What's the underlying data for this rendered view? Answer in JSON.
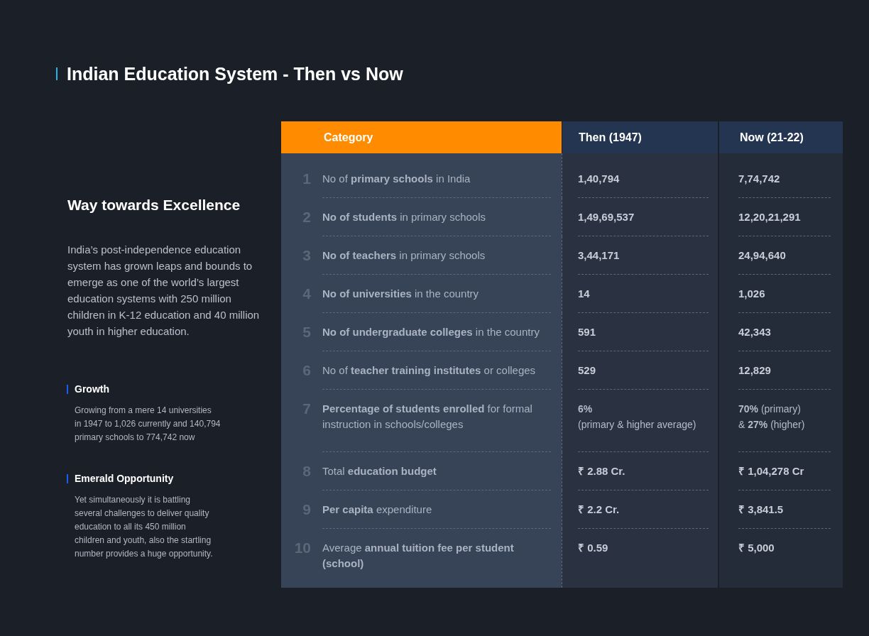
{
  "title": "Indian Education System - Then vs Now",
  "intro": {
    "heading": "Way towards Excellence",
    "text": "India’s post-independence education system has grown leaps and bounds to emerge as one of the world’s largest education systems with 250 million children in K-12 education and 40 million youth in higher education."
  },
  "highlights": [
    {
      "heading": "Growth",
      "text": "Growing from a mere 14 universities\nin 1947 to 1,026 currently and 140,794\nprimary schools to 774,742 now"
    },
    {
      "heading": "Emerald Opportunity",
      "text": "Yet simultaneously it is battling\nseveral challenges to deliver quality\neducation to all its 450 million\nchildren and youth, also the startling\nnumber provides a huge opportunity."
    }
  ],
  "table": {
    "columns": [
      "Category",
      "Then (1947)",
      "Now (21-22)"
    ],
    "rows": [
      {
        "number": "1",
        "category": "No of **primary schools** in India",
        "kind": "figure",
        "then": "1,40,794",
        "now": "7,74,742"
      },
      {
        "number": "2",
        "category": "**No of students** in primary schools",
        "kind": "figure",
        "then": "1,49,69,537",
        "now": "12,20,21,291"
      },
      {
        "number": "3",
        "category": "**No of teachers** in primary schools",
        "kind": "figure",
        "then": "3,44,171",
        "now": "24,94,640"
      },
      {
        "number": "4",
        "category": "**No of universities** in the country",
        "kind": "figure",
        "then": "14",
        "now": "1,026"
      },
      {
        "number": "5",
        "category": "**No of undergraduate colleges** in the country",
        "kind": "figure",
        "then": "591",
        "now": "42,343"
      },
      {
        "number": "6",
        "category": "No of **teacher training institutes** or colleges",
        "kind": "figure",
        "then": "529",
        "now": "12,829"
      },
      {
        "number": "7",
        "category": "**Percentage of students enrolled** for formal instruction in schools/colleges",
        "kind": "note",
        "then": "**6%**\n(primary & higher average)",
        "now": "**70%** (primary)\n& **27%** (higher)"
      },
      {
        "number": "8",
        "category": "Total **education budget**",
        "kind": "figure",
        "then": "₹ 2.88 Cr.",
        "now": "₹ 1,04,278 Cr"
      },
      {
        "number": "9",
        "category": "**Per capita** expenditure",
        "kind": "figure",
        "then": "₹ 2.2 Cr.",
        "now": "₹ 3,841.5"
      },
      {
        "number": "10",
        "category": "Average **annual tuition fee per student (school)**",
        "kind": "figure",
        "then": "₹ 0.59",
        "now": "₹ 5,000"
      }
    ]
  }
}
